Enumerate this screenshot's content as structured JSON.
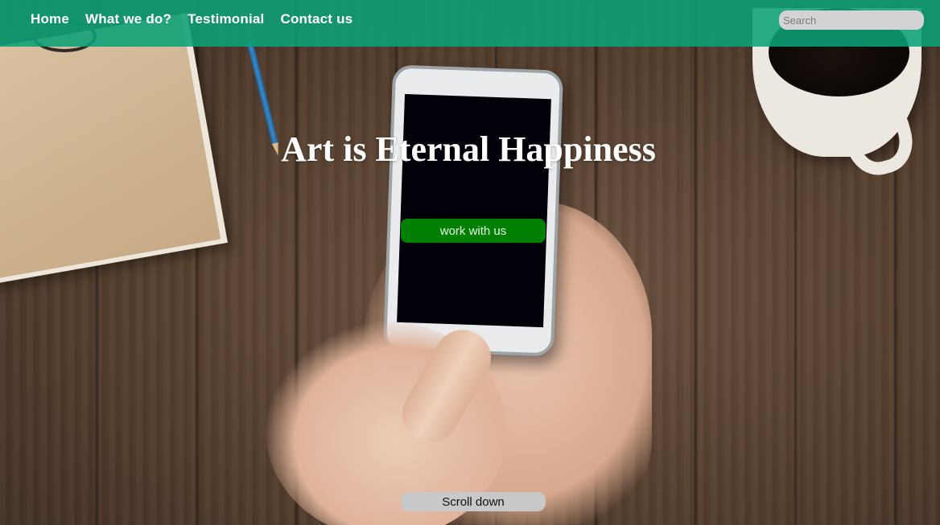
{
  "nav": {
    "links": [
      {
        "label": "Home"
      },
      {
        "label": "What we do?"
      },
      {
        "label": "Testimonial"
      },
      {
        "label": "Contact us"
      }
    ],
    "search": {
      "placeholder": "Search",
      "value": ""
    }
  },
  "hero": {
    "title": "Art is Eternal Happiness",
    "cta_label": "work with us",
    "scroll_label": "Scroll down"
  },
  "colors": {
    "navbar": "#0ca076",
    "cta": "#008000",
    "scroll_button": "#c8c8c8"
  }
}
